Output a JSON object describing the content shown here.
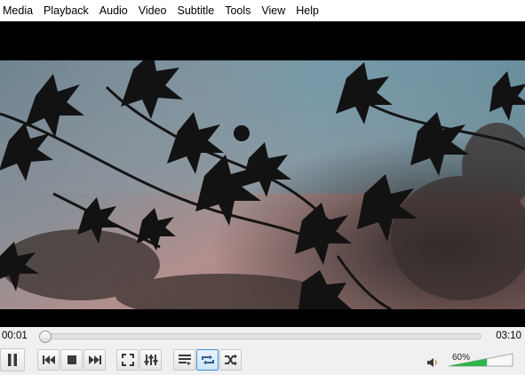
{
  "menu": [
    "Media",
    "Playback",
    "Audio",
    "Video",
    "Subtitle",
    "Tools",
    "View",
    "Help"
  ],
  "time": {
    "elapsed": "00:01",
    "total": "03:10"
  },
  "seek": {
    "progress": 0.01
  },
  "volume": {
    "label": "60%",
    "level": 0.6
  },
  "controls": {
    "pause": "pause-icon",
    "previous": "previous-icon",
    "stop": "stop-icon",
    "next": "next-icon",
    "fullscreen": "fullscreen-icon",
    "extended_settings": "equalizer-icon",
    "playlist": "playlist-icon",
    "loop": "loop-icon",
    "random": "shuffle-icon"
  },
  "colors": {
    "loop_active": "#3c8fd8",
    "volume_fill": "#2fb34a"
  }
}
